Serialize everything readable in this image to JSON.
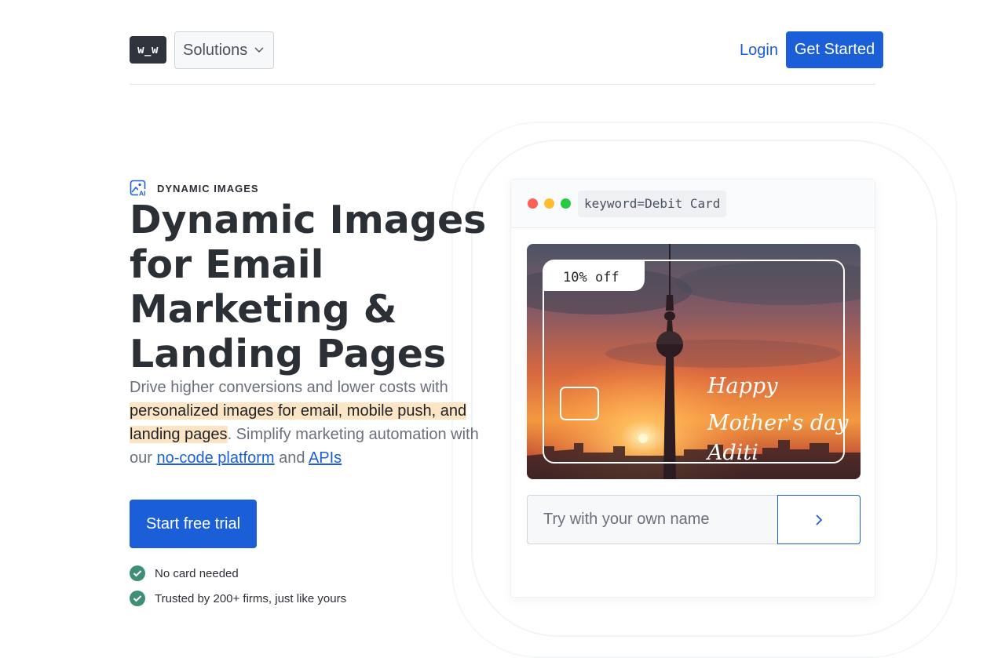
{
  "header": {
    "logo_text": "w_w",
    "solutions_label": "Solutions",
    "login_label": "Login",
    "get_started_label": "Get Started"
  },
  "hero": {
    "eyebrow": "DYNAMIC IMAGES",
    "headline": "Dynamic Images for Email Marketing & Landing Pages",
    "desc_intro": "Drive higher conversions and lower costs with ",
    "desc_highlight": "personalized images for email, mobile push, and landing pages",
    "desc_mid": ". Simplify marketing automation with our ",
    "desc_link1": "no-code platform",
    "desc_and": " and ",
    "desc_link2": "APIs",
    "cta_label": "Start free trial",
    "checks": [
      "No card needed",
      "Trusted by 200+ firms, just like yours"
    ]
  },
  "demo": {
    "keyword": "keyword=Debit Card",
    "badge": "10% off",
    "card_line1": "Happy",
    "card_line2": "Mother's day",
    "card_line3": "Aditi",
    "input_placeholder": "Try with your own name"
  },
  "colors": {
    "accent": "#1a5fd8",
    "dot_red": "#ff5f57",
    "dot_yellow": "#febc2e",
    "dot_green": "#28c840",
    "check_green": "#3e8e78",
    "highlight": "#fce5c4"
  },
  "icons": [
    "chevron-down-icon",
    "ai-image-icon",
    "checkmark-icon",
    "chevron-right-icon"
  ]
}
